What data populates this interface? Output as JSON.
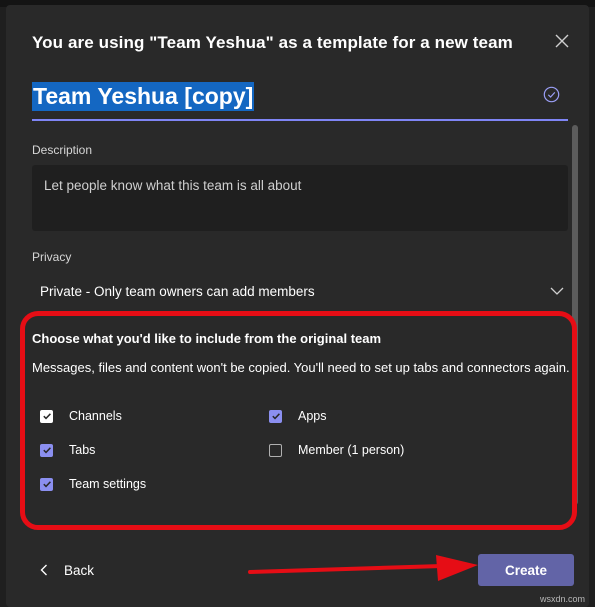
{
  "dialog": {
    "title": "You are using \"Team Yeshua\" as a template for a new team",
    "team_name": "Team Yeshua [copy]"
  },
  "description": {
    "label": "Description",
    "placeholder": "Let people know what this team is all about"
  },
  "privacy": {
    "label": "Privacy",
    "selected": "Private - Only team owners can add members"
  },
  "include": {
    "title": "Choose what you'd like to include from the original team",
    "note": "Messages, files and content won't be copied. You'll need to set up tabs and connectors again.",
    "options": [
      {
        "label": "Channels",
        "checked": true
      },
      {
        "label": "Apps",
        "checked": true
      },
      {
        "label": "Tabs",
        "checked": true
      },
      {
        "label": "Member (1 person)",
        "checked": false
      },
      {
        "label": "Team settings",
        "checked": true
      }
    ]
  },
  "footer": {
    "back_label": "Back",
    "create_label": "Create"
  },
  "colors": {
    "accent": "#6264a7",
    "highlight": "#e60d15",
    "name_selection": "#1467c2"
  },
  "watermark": "wsxdn.com"
}
